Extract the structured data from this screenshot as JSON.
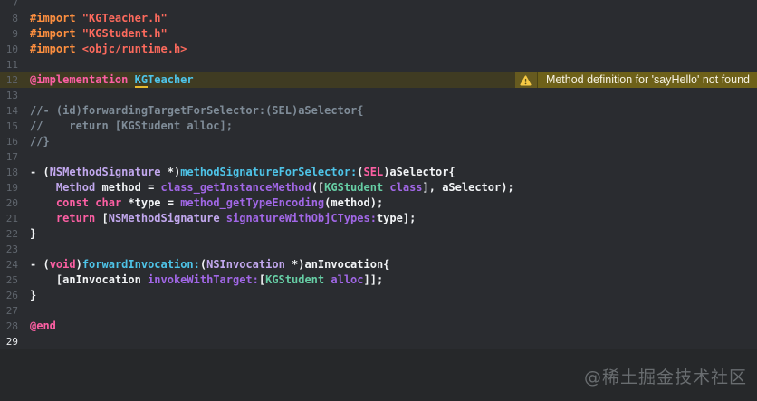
{
  "app": {
    "type": "code-editor",
    "theme": "dark",
    "language": "objective-c"
  },
  "colors": {
    "editor-bg": "#2a2c30",
    "empty-bg": "#26282a",
    "gutter": "#60666e",
    "gutter-current": "#e9ebee",
    "pln": "#f2f4f6",
    "kw": "#fc5fa3",
    "pp": "#fd8f3f",
    "str": "#fc6a5d",
    "cmt": "#7f8c98",
    "cyan": "#4ec4e8",
    "cls": "#c2a8ee",
    "fn": "#a167e6",
    "proj": "#66cda4",
    "warn-row-bg": "#3f3b22",
    "warn-icon-bg": "#665a1f",
    "warn-msg-bg": "#6e6119",
    "warn-divider": "#4a4214",
    "warn-triangle": "#f6c944",
    "warn-underline": "#e7ba2c",
    "watermark": "#696d70"
  },
  "warning": {
    "line": 12,
    "icon": "warning-triangle-icon",
    "message": "Method definition for 'sayHello' not found"
  },
  "watermark": {
    "text": "@稀土掘金技术社区"
  },
  "code": {
    "current_line": 29,
    "lines": [
      {
        "n": 7,
        "tokens": []
      },
      {
        "n": 8,
        "tokens": [
          [
            "#import ",
            "pp"
          ],
          [
            "\"KGTeacher.h\"",
            "str"
          ]
        ]
      },
      {
        "n": 9,
        "tokens": [
          [
            "#import ",
            "pp"
          ],
          [
            "\"KGStudent.h\"",
            "str"
          ]
        ]
      },
      {
        "n": 10,
        "tokens": [
          [
            "#import ",
            "pp"
          ],
          [
            "<objc/runtime.h>",
            "str"
          ]
        ]
      },
      {
        "n": 11,
        "tokens": []
      },
      {
        "n": 12,
        "warning": true,
        "tokens": [
          [
            "@implementation ",
            "kw"
          ],
          [
            "KG",
            "cyan",
            "u"
          ],
          [
            "Teacher",
            "cyan"
          ]
        ]
      },
      {
        "n": 13,
        "tokens": []
      },
      {
        "n": 14,
        "tokens": [
          [
            "//- (id)forwardingTargetForSelector:(SEL)aSelector{",
            "cmt"
          ]
        ]
      },
      {
        "n": 15,
        "tokens": [
          [
            "//    return [KGStudent alloc];",
            "cmt"
          ]
        ]
      },
      {
        "n": 16,
        "tokens": [
          [
            "//}",
            "cmt"
          ]
        ]
      },
      {
        "n": 17,
        "tokens": []
      },
      {
        "n": 18,
        "tokens": [
          [
            "- (",
            "pln"
          ],
          [
            "NSMethodSignature",
            "cls"
          ],
          [
            " *)",
            "pln"
          ],
          [
            "methodSignatureForSelector:",
            "cyan"
          ],
          [
            "(",
            "pln"
          ],
          [
            "SEL",
            "kw"
          ],
          [
            ")aSelector{",
            "pln"
          ]
        ]
      },
      {
        "n": 19,
        "tokens": [
          [
            "    ",
            "pln"
          ],
          [
            "Method",
            "cls"
          ],
          [
            " method = ",
            "pln"
          ],
          [
            "class_getInstanceMethod",
            "fn"
          ],
          [
            "([",
            "pln"
          ],
          [
            "KGStudent",
            "proj"
          ],
          [
            " ",
            "pln"
          ],
          [
            "class",
            "fn"
          ],
          [
            "], aSelector);",
            "pln"
          ]
        ]
      },
      {
        "n": 20,
        "tokens": [
          [
            "    ",
            "pln"
          ],
          [
            "const",
            "kw"
          ],
          [
            " ",
            "pln"
          ],
          [
            "char",
            "kw"
          ],
          [
            " *type = ",
            "pln"
          ],
          [
            "method_getTypeEncoding",
            "fn"
          ],
          [
            "(method);",
            "pln"
          ]
        ]
      },
      {
        "n": 21,
        "tokens": [
          [
            "    ",
            "pln"
          ],
          [
            "return",
            "kw"
          ],
          [
            " [",
            "pln"
          ],
          [
            "NSMethodSignature",
            "cls"
          ],
          [
            " ",
            "pln"
          ],
          [
            "signatureWithObjCTypes:",
            "fn"
          ],
          [
            "type];",
            "pln"
          ]
        ]
      },
      {
        "n": 22,
        "tokens": [
          [
            "}",
            "pln"
          ]
        ]
      },
      {
        "n": 23,
        "tokens": []
      },
      {
        "n": 24,
        "tokens": [
          [
            "- (",
            "pln"
          ],
          [
            "void",
            "kw"
          ],
          [
            ")",
            "pln"
          ],
          [
            "forwardInvocation:",
            "cyan"
          ],
          [
            "(",
            "pln"
          ],
          [
            "NSInvocation",
            "cls"
          ],
          [
            " *)anInvocation{",
            "pln"
          ]
        ]
      },
      {
        "n": 25,
        "tokens": [
          [
            "    [anInvocation ",
            "pln"
          ],
          [
            "invokeWithTarget:",
            "fn"
          ],
          [
            "[",
            "pln"
          ],
          [
            "KGStudent",
            "proj"
          ],
          [
            " ",
            "pln"
          ],
          [
            "alloc",
            "fn"
          ],
          [
            "]];",
            "pln"
          ]
        ]
      },
      {
        "n": 26,
        "tokens": [
          [
            "}",
            "pln"
          ]
        ]
      },
      {
        "n": 27,
        "tokens": []
      },
      {
        "n": 28,
        "tokens": [
          [
            "@end",
            "kw"
          ]
        ]
      },
      {
        "n": 29,
        "current": true,
        "tokens": []
      }
    ]
  }
}
